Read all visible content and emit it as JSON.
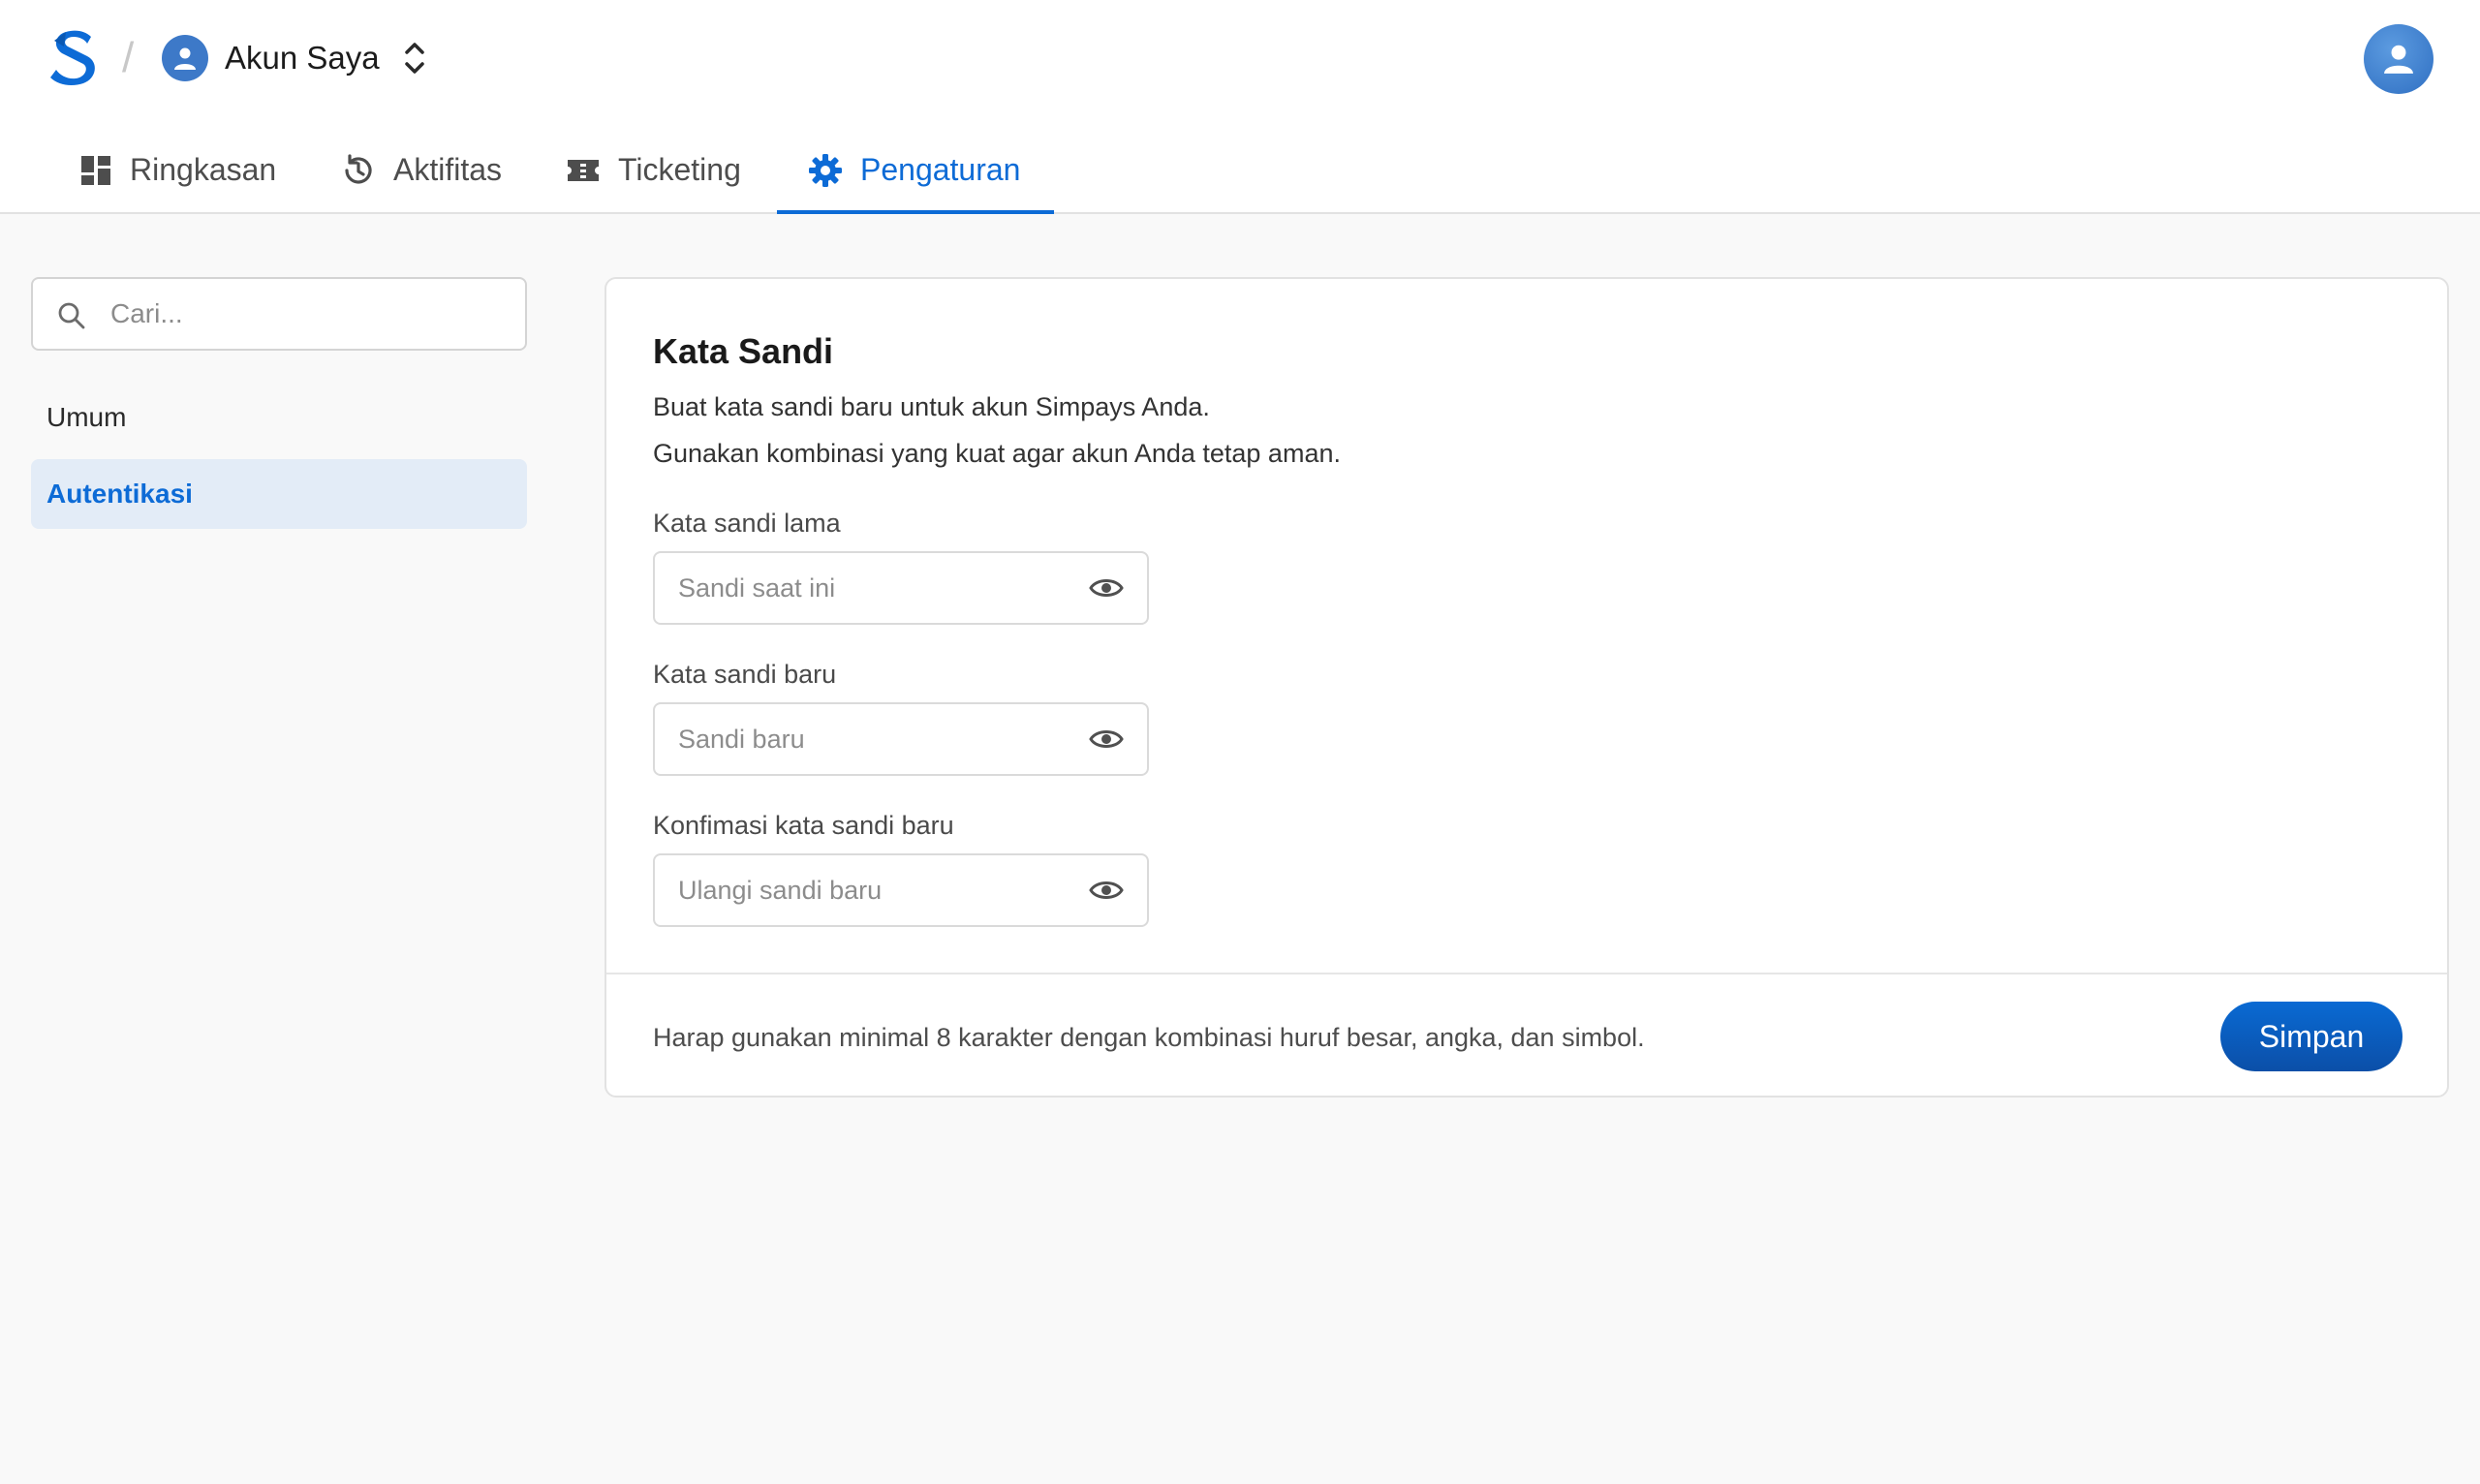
{
  "header": {
    "separator": "/",
    "account_name": "Akun Saya"
  },
  "tabs": [
    {
      "label": "Ringkasan",
      "icon": "dashboard-icon"
    },
    {
      "label": "Aktifitas",
      "icon": "history-icon"
    },
    {
      "label": "Ticketing",
      "icon": "ticket-icon"
    },
    {
      "label": "Pengaturan",
      "icon": "gear-icon",
      "active": true
    }
  ],
  "sidebar": {
    "search_placeholder": "Cari...",
    "items": [
      {
        "label": "Umum"
      },
      {
        "label": "Autentikasi",
        "active": true
      }
    ]
  },
  "card": {
    "title": "Kata Sandi",
    "desc_line1": "Buat kata sandi baru untuk akun Simpays Anda.",
    "desc_line2": "Gunakan kombinasi yang kuat agar akun Anda tetap aman.",
    "fields": [
      {
        "label": "Kata sandi lama",
        "placeholder": "Sandi saat ini",
        "value": ""
      },
      {
        "label": "Kata sandi baru",
        "placeholder": "Sandi baru",
        "value": ""
      },
      {
        "label": "Konfimasi kata sandi baru",
        "placeholder": "Ulangi sandi baru",
        "value": ""
      }
    ],
    "hint": "Harap gunakan minimal 8 karakter dengan kombinasi huruf besar, angka, dan simbol.",
    "save_label": "Simpan"
  },
  "colors": {
    "accent": "#0d6bd6",
    "active_bg": "#e3ecf7",
    "page_bg": "#f9f9f9"
  }
}
